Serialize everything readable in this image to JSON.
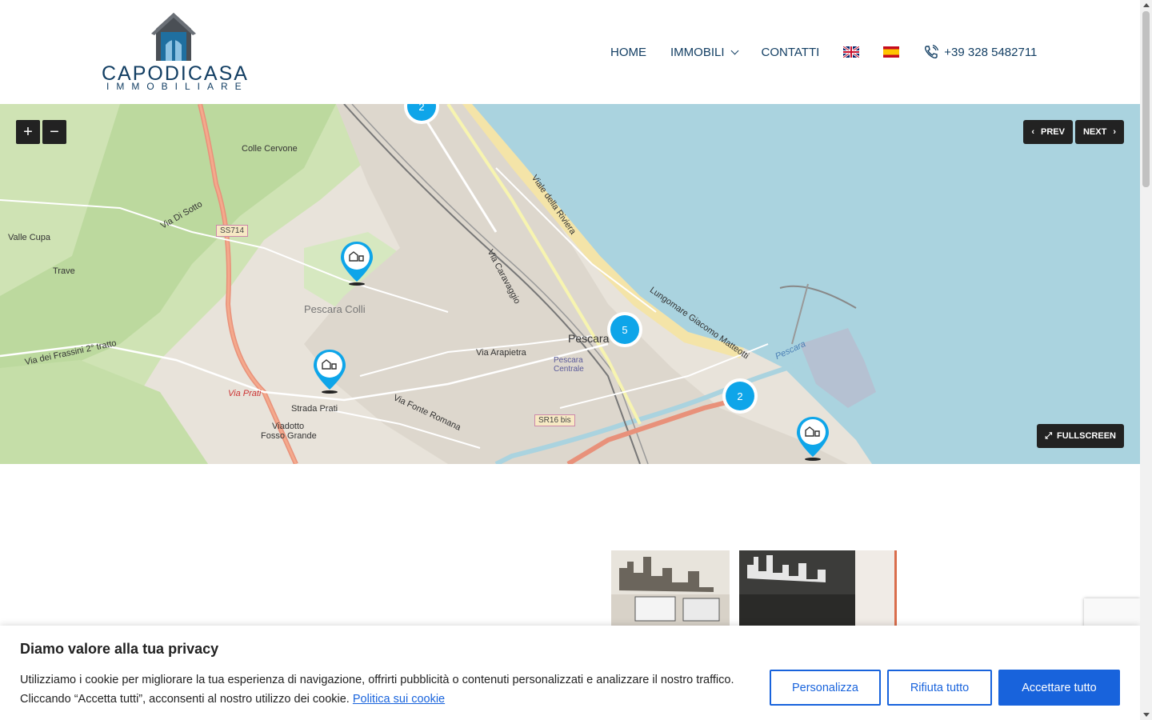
{
  "brand": {
    "name": "CAPODICASA",
    "sub": "IMMOBILIARE"
  },
  "nav": {
    "home": "HOME",
    "immobili": "IMMOBILI",
    "contatti": "CONTATTI",
    "phone": "+39 328 5482711"
  },
  "map": {
    "zoom_in": "+",
    "zoom_out": "−",
    "prev": "PREV",
    "next": "NEXT",
    "fullscreen": "FULLSCREEN",
    "clusters": [
      "2",
      "5",
      "2"
    ],
    "labels": {
      "colle_cervone": "Colle Cervone",
      "via_di_sotto": "Via Di Sotto",
      "valle_cupa": "Valle Cupa",
      "trave": "Trave",
      "pescara_colli": "Pescara Colli",
      "via_frassini": "Via dei Frassini 2° tratto",
      "strada_prati": "Strada Prati",
      "via_prati": "Via Prati",
      "viadotto": "Viadotto",
      "fosso_grande": "Fosso Grande",
      "via_fonte_romana": "Via Fonte Romana",
      "via_arapietra": "Via Arapietra",
      "pescara": "Pescara",
      "pescara_centrale": "Pescara Centrale",
      "viale_riviera": "Viale della Riviera",
      "via_caravaggio": "Via Caravaggio",
      "lungomare": "Lungomare Giacomo Matteotti",
      "pescara_river": "Pescara",
      "ss714": "SS714",
      "sr16": "SR16 bis"
    }
  },
  "cookie": {
    "title": "Diamo valore alla tua privacy",
    "text": "Utilizziamo i cookie per migliorare la tua esperienza di navigazione, offrirti pubblicità o contenuti personalizzati e analizzare il nostro traffico. Cliccando “Accetta tutti”, acconsenti al nostro utilizzo dei cookie.",
    "policy_link": "Politica sui cookie",
    "customize": "Personalizza",
    "reject": "Rifiuta tutto",
    "accept": "Accettare tutto"
  }
}
